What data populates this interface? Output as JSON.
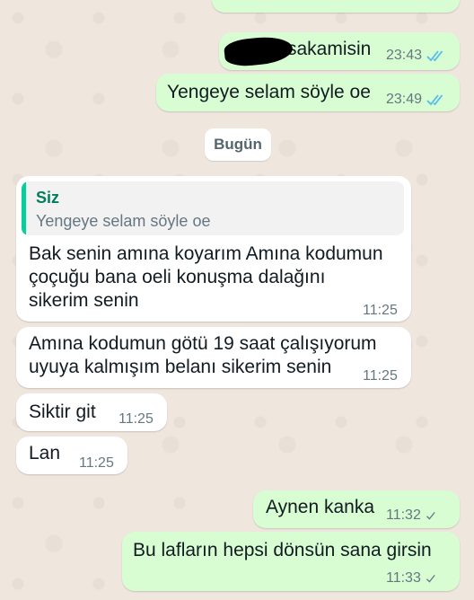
{
  "conversation": {
    "date_separator": "Bugün",
    "messages": [
      {
        "id": "m1",
        "direction": "outgoing",
        "text": "sakamisin",
        "time": "23:43",
        "status": "read"
      },
      {
        "id": "m2",
        "direction": "outgoing",
        "text": "Yengeye selam söyle oe",
        "time": "23:49",
        "status": "read"
      },
      {
        "id": "m3",
        "direction": "incoming",
        "reply_to": {
          "sender": "Siz",
          "text": "Yengeye selam söyle oe"
        },
        "lines": [
          "Bak senin amına koyarım Amına kodumun",
          "çoçuğu bana oeli konuşma dalağını",
          "sikerim senin"
        ],
        "time": "11:25"
      },
      {
        "id": "m4",
        "direction": "incoming",
        "lines": [
          "Amına kodumun götü 19 saat çalışıyorum",
          "uyuya kalmışım belanı sikerim senin"
        ],
        "time": "11:25"
      },
      {
        "id": "m5",
        "direction": "incoming",
        "text": "Siktir git",
        "time": "11:25"
      },
      {
        "id": "m6",
        "direction": "incoming",
        "text": "Lan",
        "time": "11:25"
      },
      {
        "id": "m7",
        "direction": "outgoing",
        "text": "Aynen kanka",
        "time": "11:32",
        "status": "sent"
      },
      {
        "id": "m8",
        "direction": "outgoing",
        "text": "Bu lafların hepsi dönsün sana girsin",
        "time": "11:33",
        "status": "sent"
      }
    ]
  },
  "colors": {
    "outgoing_bubble": "#d9fdd3",
    "incoming_bubble": "#ffffff",
    "read_tick": "#53bdeb",
    "sent_tick": "#667781",
    "quote_accent": "#06cf9c",
    "wallpaper": "#efe7de"
  },
  "icons": {
    "read": "double-check-icon",
    "sent": "single-check-icon"
  }
}
